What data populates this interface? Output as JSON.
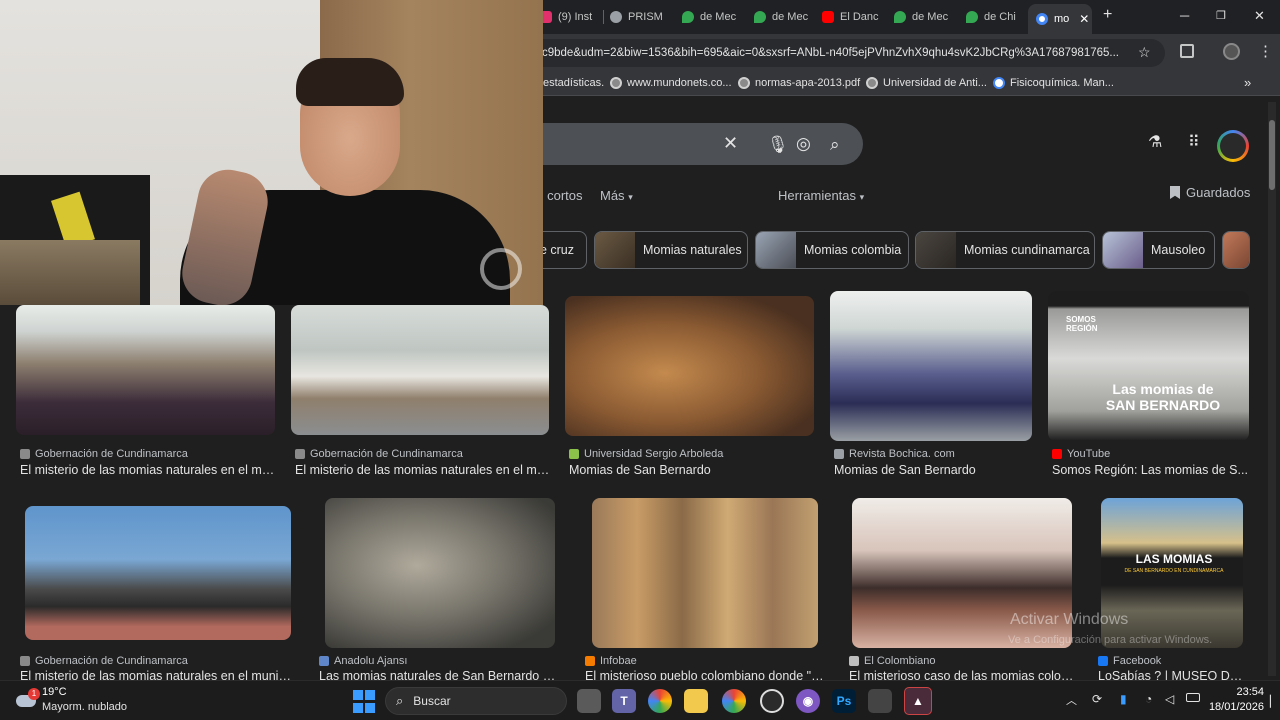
{
  "browser": {
    "tabs": [
      {
        "label": "(9) Inst",
        "icon": "instagram-icon",
        "color": "#e1306c"
      },
      {
        "label": "PRISM",
        "icon": "chrome-page-icon",
        "color": "#9aa0a6"
      },
      {
        "label": "de Mec",
        "icon": "maps-pin-icon",
        "color": "#34a853"
      },
      {
        "label": "de Mec",
        "icon": "maps-pin-icon",
        "color": "#34a853"
      },
      {
        "label": "El Danc",
        "icon": "youtube-icon",
        "color": "#ff0000"
      },
      {
        "label": "de Mec",
        "icon": "maps-pin-icon",
        "color": "#34a853"
      },
      {
        "label": "de Chi",
        "icon": "maps-pin-icon",
        "color": "#34a853"
      },
      {
        "label": "mo",
        "icon": "google-icon",
        "color": "#4285f4",
        "active": true
      }
    ],
    "new_tab": "+",
    "url": "c9bde&udm=2&biw=1536&bih=695&aic=0&sxsrf=ANbL-n40f5ejPVhnZvhX9qhu4svK2JbCRg%3A17687981765...",
    "bookmarks": [
      {
        "label": "estadísticas."
      },
      {
        "label": "www.mundonets.co..."
      },
      {
        "label": "normas-apa-2013.pdf"
      },
      {
        "label": "Universidad de Anti..."
      },
      {
        "label": "Fisicoquímica. Man..."
      }
    ]
  },
  "google": {
    "nav": {
      "shorts": "s cortos",
      "more": "Más",
      "tools": "Herramientas",
      "saved": "Guardados"
    },
    "chips": [
      "e cruz",
      "Momias naturales",
      "Momias colombia",
      "Momias cundinamarca",
      "Mausoleo"
    ],
    "results": [
      {
        "source": "Gobernación de Cundinamarca",
        "title": "El misterio de las momias naturales en el mu...",
        "color": "#7a6b5a"
      },
      {
        "source": "Gobernación de Cundinamarca",
        "title": "El misterio de las momias naturales en el mu...",
        "color": "#8e8a80"
      },
      {
        "source": "Universidad Sergio Arboleda",
        "title": "Momias de San Bernardo",
        "color": "#a0703d"
      },
      {
        "source": "Revista Bochica. com",
        "title": "Momias de San Bernardo",
        "color": "#5b5f9a"
      },
      {
        "source": "YouTube",
        "title": "Somos Región: Las momias de S...",
        "overlay": "Las momias de SAN BERNARDO",
        "badge": "SOMOS REGIÓN",
        "color": "#6d6d6d"
      },
      {
        "source": "Gobernación de Cundinamarca",
        "title": "El misterio de las momias naturales en el munici...",
        "color": "#5d8fc4"
      },
      {
        "source": "Anadolu Ajansı",
        "title": "Las momias naturales de San Bernardo se...",
        "color": "#6b6b66"
      },
      {
        "source": "Infobae",
        "title": "El misterioso pueblo colombiano donde \"lo...",
        "color": "#b08858"
      },
      {
        "source": "El Colombiano",
        "title": "El misterioso caso de las momias colom...",
        "color": "#c9a79a"
      },
      {
        "source": "Facebook",
        "title": "LoSabías ? | MUSEO DE...",
        "overlay": "LAS MOMIAS",
        "overlay_sub": "DE SAN BERNARDO EN CUNDINAMARCA",
        "color": "#6a6656"
      }
    ],
    "watermark": "Activar Windows",
    "watermark_sub": "Ve a Configuración para activar Windows."
  },
  "taskbar": {
    "weather_temp": "19°C",
    "weather_desc": "Mayorm. nublado",
    "weather_badge": "1",
    "search_placeholder": "Buscar",
    "time": "23:54",
    "date": "18/01/2026"
  }
}
